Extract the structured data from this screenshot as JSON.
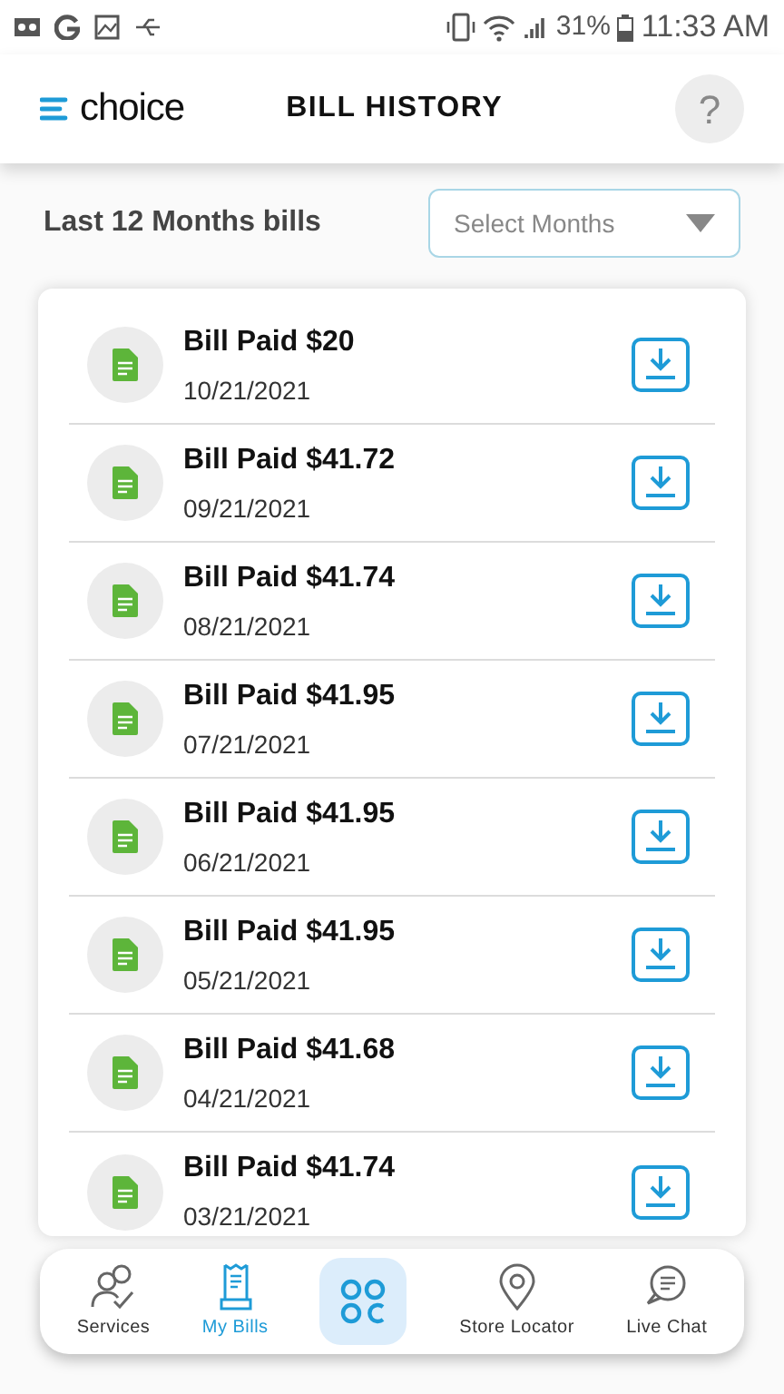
{
  "status_bar": {
    "battery": "31%",
    "time": "11:33 AM"
  },
  "header": {
    "logo": "choice",
    "title": "BILL HISTORY",
    "help": "?"
  },
  "filter": {
    "label": "Last 12 Months bills",
    "dropdown": {
      "placeholder": "Select Months"
    }
  },
  "bills": [
    {
      "title": "Bill Paid $20",
      "date": "10/21/2021"
    },
    {
      "title": "Bill Paid $41.72",
      "date": "09/21/2021"
    },
    {
      "title": "Bill Paid $41.74",
      "date": "08/21/2021"
    },
    {
      "title": "Bill Paid $41.95",
      "date": "07/21/2021"
    },
    {
      "title": "Bill Paid $41.95",
      "date": "06/21/2021"
    },
    {
      "title": "Bill Paid $41.95",
      "date": "05/21/2021"
    },
    {
      "title": "Bill Paid $41.68",
      "date": "04/21/2021"
    },
    {
      "title": "Bill Paid $41.74",
      "date": "03/21/2021"
    }
  ],
  "nav": [
    {
      "kind": "services",
      "label": "Services",
      "selected": false
    },
    {
      "kind": "bills",
      "label": "My Bills",
      "selected": true
    },
    {
      "kind": "home",
      "selected": false
    },
    {
      "kind": "store",
      "label": "Store Locator",
      "selected": false
    },
    {
      "kind": "chat",
      "label": "Live Chat",
      "selected": false
    }
  ]
}
